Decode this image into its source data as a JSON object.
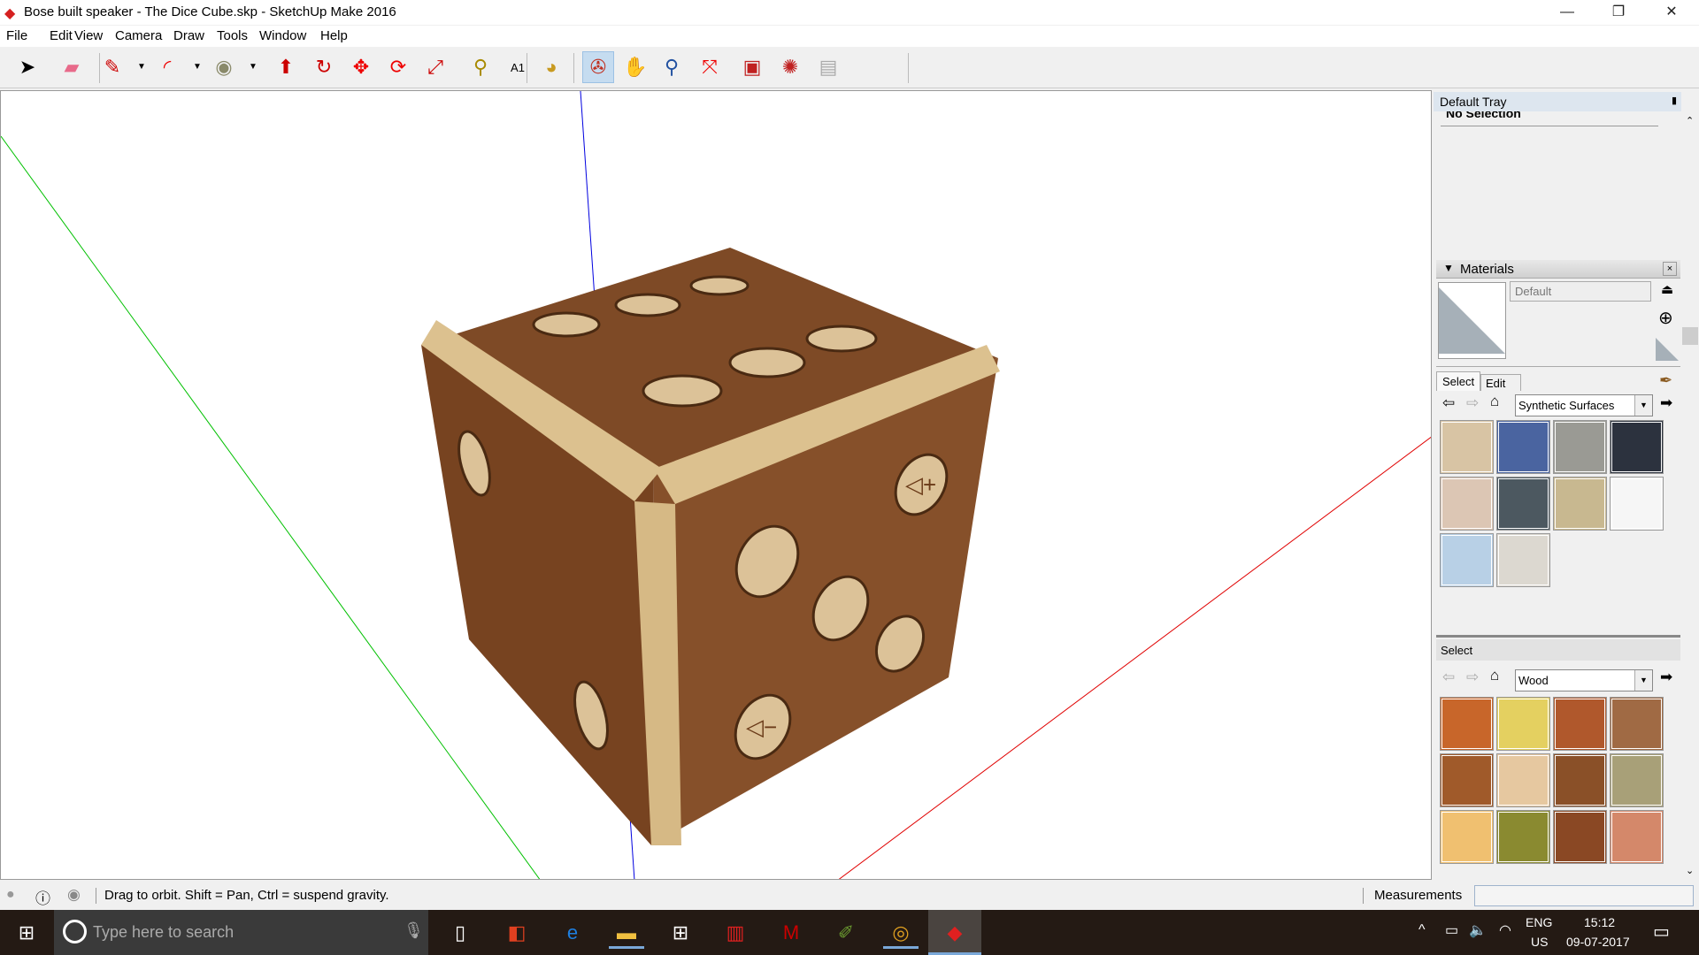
{
  "window": {
    "title": "Bose built speaker - The Dice Cube.skp - SketchUp Make 2016",
    "minimize": "—",
    "restore": "❐",
    "close": "✕"
  },
  "menu": [
    "File",
    "Edit",
    "View",
    "Camera",
    "Draw",
    "Tools",
    "Window",
    "Help"
  ],
  "toolbar": [
    {
      "name": "select-tool",
      "glyph": "➤",
      "color": "#000"
    },
    {
      "name": "eraser-tool",
      "glyph": "▰",
      "color": "#e86a8a"
    },
    {
      "name": "line-tool",
      "glyph": "✎",
      "color": "#c00"
    },
    {
      "name": "arc-tool",
      "glyph": "◜",
      "color": "#e00"
    },
    {
      "name": "circle-tool",
      "glyph": "◉",
      "color": "#8a8a6a"
    },
    {
      "name": "push-pull-tool",
      "glyph": "⬆",
      "color": "#c00"
    },
    {
      "name": "follow-me-tool",
      "glyph": "↻",
      "color": "#c00"
    },
    {
      "name": "move-tool",
      "glyph": "✥",
      "color": "#e00"
    },
    {
      "name": "rotate-tool",
      "glyph": "⟳",
      "color": "#e00"
    },
    {
      "name": "scale-tool",
      "glyph": "⤢",
      "color": "#c00"
    },
    {
      "name": "tape-measure-tool",
      "glyph": "⚲",
      "color": "#a88a00"
    },
    {
      "name": "text-tool",
      "glyph": "A1",
      "color": "#000"
    },
    {
      "name": "paint-bucket-tool",
      "glyph": "◕",
      "color": "#c89a20"
    },
    {
      "name": "orbit-tool",
      "glyph": "✇",
      "color": "#c03020",
      "active": true
    },
    {
      "name": "pan-tool",
      "glyph": "✋",
      "color": "#d8c8a0"
    },
    {
      "name": "zoom-tool",
      "glyph": "⚲",
      "color": "#2050a0"
    },
    {
      "name": "zoom-extents-tool",
      "glyph": "⤧",
      "color": "#e00"
    },
    {
      "name": "3d-warehouse-button",
      "glyph": "▣",
      "color": "#c02020"
    },
    {
      "name": "extension-warehouse-button",
      "glyph": "✺",
      "color": "#c02020"
    },
    {
      "name": "layout-button",
      "glyph": "▤",
      "color": "#aaa"
    }
  ],
  "tray": {
    "title": "Default Tray",
    "pin": "📌",
    "close": "×",
    "entity_info": "No Selection",
    "materials": {
      "title": "Materials",
      "close": "×",
      "name_value": "Default",
      "tabs": [
        "Select",
        "Edit"
      ],
      "library": "Synthetic Surfaces",
      "swatches": [
        "#d8c4a4",
        "#4a64a0",
        "#9a9a94",
        "#2c323e",
        "#dcc6b4",
        "#4c5860",
        "#c8b890",
        "#f6f6f6",
        "#b8d0e6",
        "#dcd8d0"
      ],
      "secondary_label": "Select",
      "secondary_library": "Wood",
      "wood_swatches": [
        "#c8662a",
        "#e4d060",
        "#b0582c",
        "#a06a44",
        "#a05a2a",
        "#e6c8a0",
        "#8a5028",
        "#a8a078",
        "#f0c070",
        "#8a8a30",
        "#8a4824",
        "#d4886a"
      ]
    }
  },
  "status": {
    "message": "Drag to orbit. Shift = Pan, Ctrl = suspend gravity.",
    "measurements_label": "Measurements",
    "measurements_value": ""
  },
  "taskbar": {
    "search_placeholder": "Type here to search",
    "lang1": "ENG",
    "lang2": "US",
    "time": "15:12",
    "date": "09-07-2017",
    "apps": [
      {
        "name": "task-view",
        "glyph": "▯",
        "color": "#fff"
      },
      {
        "name": "app-red",
        "glyph": "◧",
        "color": "#e04020"
      },
      {
        "name": "edge",
        "glyph": "e",
        "color": "#1e7fe0"
      },
      {
        "name": "file-explorer",
        "glyph": "▬",
        "color": "#f0c040"
      },
      {
        "name": "store",
        "glyph": "⊞",
        "color": "#fff"
      },
      {
        "name": "reader",
        "glyph": "▥",
        "color": "#e02020"
      },
      {
        "name": "mcafee",
        "glyph": "M",
        "color": "#c00"
      },
      {
        "name": "paint",
        "glyph": "✐",
        "color": "#6a9a30"
      },
      {
        "name": "chrome",
        "glyph": "◎",
        "color": "#e0a020"
      },
      {
        "name": "sketchup",
        "glyph": "◆",
        "color": "#e02020"
      }
    ]
  },
  "colors": {
    "x_axis": "#e00000",
    "y_axis": "#00c000",
    "z_axis": "#0000e0",
    "wood_dark": "#7e4722",
    "wood_light": "#dcc18f"
  }
}
